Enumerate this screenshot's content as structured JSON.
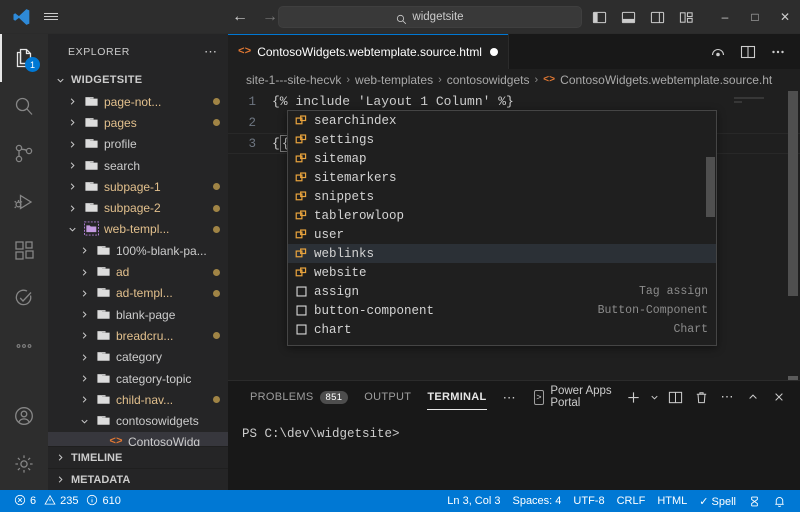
{
  "titlebar": {
    "logo_icon": "vscode-logo-icon",
    "menu_icon": "hamburger-menu-icon",
    "back_icon": "back-arrow-icon",
    "forward_icon": "forward-arrow-icon",
    "search": {
      "icon": "search-icon",
      "value": "widgetsite",
      "placeholder": "Search"
    },
    "layout_icons": [
      "toggle-primary-sidebar-icon",
      "toggle-panel-icon",
      "toggle-secondary-sidebar-icon",
      "customize-layout-icon"
    ],
    "window_controls": {
      "minimize": "–",
      "maximize": "□",
      "close": "✕"
    }
  },
  "activitybar": {
    "items": [
      {
        "name": "explorer",
        "icon": "files-icon",
        "badge": "1",
        "active": true
      },
      {
        "name": "search",
        "icon": "search-icon",
        "badge": "",
        "active": false
      },
      {
        "name": "source-control",
        "icon": "source-control-icon",
        "badge": "",
        "active": false
      },
      {
        "name": "run-and-debug",
        "icon": "run-debug-icon",
        "badge": "",
        "active": false
      },
      {
        "name": "extensions",
        "icon": "extensions-icon",
        "badge": "",
        "active": false
      },
      {
        "name": "testing",
        "icon": "testing-icon",
        "badge": "",
        "active": false
      },
      {
        "name": "more-views",
        "icon": "ellipsis-icon",
        "badge": "",
        "active": false
      }
    ],
    "bottom_items": [
      {
        "name": "accounts",
        "icon": "account-icon"
      },
      {
        "name": "manage",
        "icon": "gear-icon"
      }
    ]
  },
  "sidebar": {
    "title": "EXPLORER",
    "more_actions_icon": "ellipsis-icon",
    "root_section": "WIDGETSITE",
    "tree": [
      {
        "label": "page-not...",
        "indent": 1,
        "type": "folder",
        "expanded": false,
        "modified": true,
        "selected": false
      },
      {
        "label": "pages",
        "indent": 1,
        "type": "folder",
        "expanded": false,
        "modified": true,
        "selected": false
      },
      {
        "label": "profile",
        "indent": 1,
        "type": "folder",
        "expanded": false,
        "modified": false,
        "selected": false
      },
      {
        "label": "search",
        "indent": 1,
        "type": "folder",
        "expanded": false,
        "modified": false,
        "selected": false
      },
      {
        "label": "subpage-1",
        "indent": 1,
        "type": "folder",
        "expanded": false,
        "modified": true,
        "selected": false
      },
      {
        "label": "subpage-2",
        "indent": 1,
        "type": "folder",
        "expanded": false,
        "modified": true,
        "selected": false
      },
      {
        "label": "web-templ...",
        "indent": 1,
        "type": "folder-open-highlight",
        "expanded": true,
        "modified": true,
        "selected": false
      },
      {
        "label": "100%-blank-pa...",
        "indent": 2,
        "type": "folder",
        "expanded": false,
        "modified": false,
        "selected": false
      },
      {
        "label": "ad",
        "indent": 2,
        "type": "folder",
        "expanded": false,
        "modified": true,
        "selected": false
      },
      {
        "label": "ad-templ...",
        "indent": 2,
        "type": "folder",
        "expanded": false,
        "modified": true,
        "selected": false
      },
      {
        "label": "blank-page",
        "indent": 2,
        "type": "folder",
        "expanded": false,
        "modified": false,
        "selected": false
      },
      {
        "label": "breadcru...",
        "indent": 2,
        "type": "folder",
        "expanded": false,
        "modified": true,
        "selected": false
      },
      {
        "label": "category",
        "indent": 2,
        "type": "folder",
        "expanded": false,
        "modified": false,
        "selected": false
      },
      {
        "label": "category-topic",
        "indent": 2,
        "type": "folder",
        "expanded": false,
        "modified": false,
        "selected": false
      },
      {
        "label": "child-nav...",
        "indent": 2,
        "type": "folder",
        "expanded": false,
        "modified": true,
        "selected": false
      },
      {
        "label": "contosowidgets",
        "indent": 2,
        "type": "folder",
        "expanded": true,
        "modified": false,
        "selected": false
      },
      {
        "label": "ContosoWidg",
        "indent": 3,
        "type": "html-file",
        "expanded": false,
        "modified": false,
        "selected": true
      }
    ],
    "bottom_panels": [
      {
        "label": "TIMELINE",
        "expanded": false
      },
      {
        "label": "METADATA",
        "expanded": false
      }
    ]
  },
  "editor": {
    "tab": {
      "icon": "html-file-icon",
      "label": "ContosoWidgets.webtemplate.source.html",
      "dirty": true
    },
    "tab_actions": [
      "editor-actions-icon",
      "split-editor-icon",
      "more-actions-icon"
    ],
    "breadcrumb": [
      "site-1---site-hecvk",
      "web-templates",
      "contosowidgets",
      "ContosoWidgets.webtemplate.source.ht"
    ],
    "breadcrumb_separator": "›",
    "lines": [
      {
        "num": "1",
        "text": "{% include 'Layout 1 Column' %}"
      },
      {
        "num": "2",
        "text": ""
      },
      {
        "num": "3",
        "text": "{{}}"
      }
    ]
  },
  "suggest": {
    "selected_index": 7,
    "items": [
      {
        "label": "searchindex",
        "icon": "field-icon",
        "detail": ""
      },
      {
        "label": "settings",
        "icon": "field-icon",
        "detail": ""
      },
      {
        "label": "sitemap",
        "icon": "field-icon",
        "detail": ""
      },
      {
        "label": "sitemarkers",
        "icon": "field-icon",
        "detail": ""
      },
      {
        "label": "snippets",
        "icon": "field-icon",
        "detail": ""
      },
      {
        "label": "tablerowloop",
        "icon": "field-icon",
        "detail": ""
      },
      {
        "label": "user",
        "icon": "field-icon",
        "detail": ""
      },
      {
        "label": "weblinks",
        "icon": "field-icon",
        "detail": ""
      },
      {
        "label": "website",
        "icon": "field-icon",
        "detail": ""
      },
      {
        "label": "assign",
        "icon": "keyword-icon",
        "detail": "Tag assign"
      },
      {
        "label": "button-component",
        "icon": "keyword-icon",
        "detail": "Button-Component"
      },
      {
        "label": "chart",
        "icon": "keyword-icon",
        "detail": "Chart"
      }
    ]
  },
  "panel": {
    "tabs": [
      {
        "label": "PROBLEMS",
        "count": "851",
        "active": false
      },
      {
        "label": "OUTPUT",
        "count": "",
        "active": false
      },
      {
        "label": "TERMINAL",
        "count": "",
        "active": true
      }
    ],
    "more_tabs_icon": "ellipsis-icon",
    "terminal_name": "Power Apps Portal",
    "terminal_icon": "terminal-chevron-icon",
    "actions": [
      {
        "name": "new-terminal",
        "icon": "plus-icon"
      },
      {
        "name": "terminal-dropdown",
        "icon": "chevron-down-icon"
      },
      {
        "name": "split-terminal",
        "icon": "split-icon"
      },
      {
        "name": "kill-terminal",
        "icon": "trash-icon"
      },
      {
        "name": "panel-more",
        "icon": "ellipsis-icon"
      },
      {
        "name": "maximize-panel",
        "icon": "chevron-up-icon"
      },
      {
        "name": "close-panel",
        "icon": "close-icon"
      }
    ],
    "terminal_content": "PS C:\\dev\\widgetsite>"
  },
  "statusbar": {
    "left": [
      {
        "name": "errors",
        "icon": "error-icon",
        "text": "6"
      },
      {
        "name": "warnings",
        "icon": "warning-icon",
        "text": "235"
      },
      {
        "name": "infos",
        "icon": "info-icon",
        "text": "610"
      }
    ],
    "right": [
      {
        "name": "cursor-position",
        "text": "Ln 3, Col 3"
      },
      {
        "name": "indentation",
        "text": "Spaces: 4"
      },
      {
        "name": "encoding",
        "text": "UTF-8"
      },
      {
        "name": "eol",
        "text": "CRLF"
      },
      {
        "name": "language-mode",
        "text": "HTML"
      },
      {
        "name": "spell-checker",
        "text": "✓ Spell"
      }
    ],
    "right_icons": [
      {
        "name": "remote-indicator",
        "icon": "broadcast-icon"
      },
      {
        "name": "notifications",
        "icon": "bell-icon"
      }
    ],
    "background": "#0078d4"
  },
  "colors": {
    "accent": "#0078d4",
    "modified_folder": "#e2c08d",
    "html_icon": "#e37933",
    "suggest_field_icon": "#e8a33d",
    "selection": "#37373d"
  }
}
